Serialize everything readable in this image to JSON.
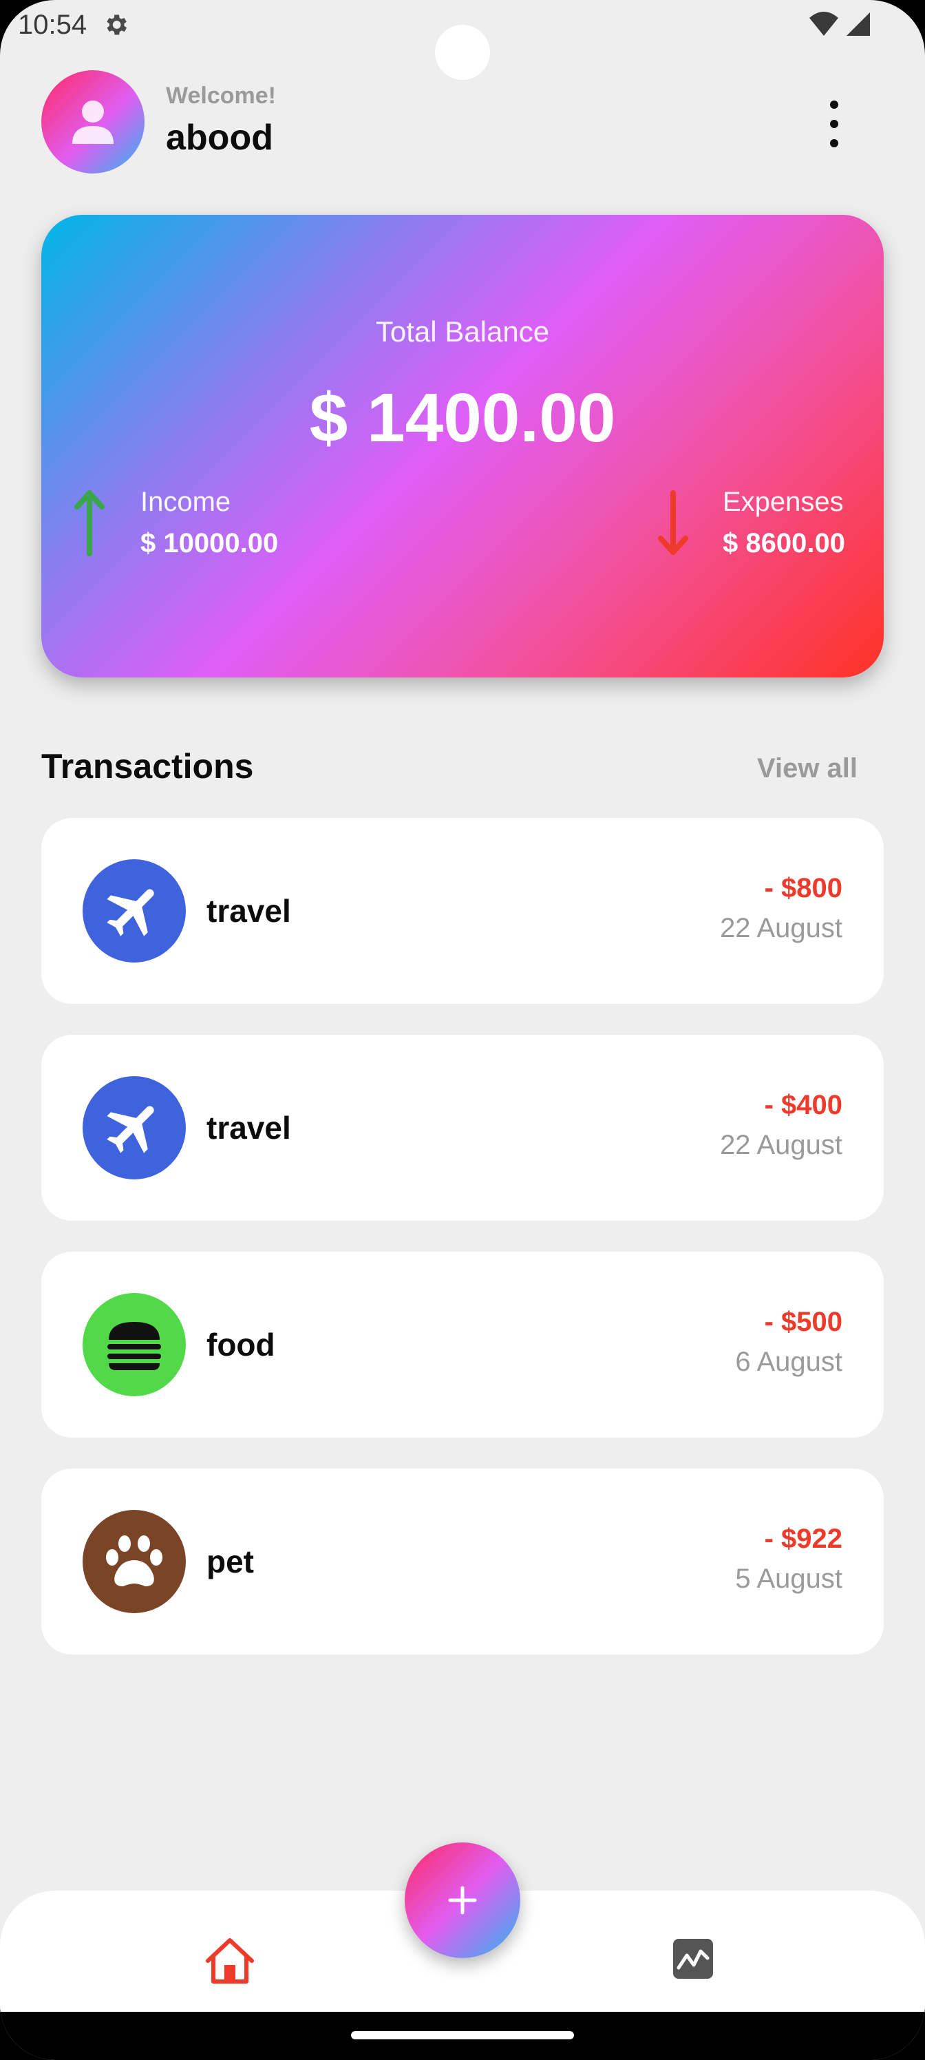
{
  "status_bar": {
    "time": "10:54"
  },
  "header": {
    "welcome": "Welcome!",
    "username": "abood"
  },
  "balance_card": {
    "label": "Total Balance",
    "amount": "$ 1400.00",
    "income_label": "Income",
    "income_value": "$ 10000.00",
    "expenses_label": "Expenses",
    "expenses_value": "$ 8600.00"
  },
  "transactions": {
    "title": "Transactions",
    "view_all": "View all",
    "items": [
      {
        "name": "travel",
        "amount": "- $800",
        "date": "22 August",
        "icon": "airplane-icon",
        "color": "#3f63dd"
      },
      {
        "name": "travel",
        "amount": "- $400",
        "date": "22 August",
        "icon": "airplane-icon",
        "color": "#3f63dd"
      },
      {
        "name": "food",
        "amount": "- $500",
        "date": "6 August",
        "icon": "burger-icon",
        "color": "#52d94a"
      },
      {
        "name": "pet",
        "amount": "- $922",
        "date": "5 August",
        "icon": "paw-icon",
        "color": "#7a4427"
      }
    ]
  },
  "colors": {
    "expense_red": "#ee3a2a",
    "income_green": "#3aa64a",
    "nav_active": "#ee3a2a"
  }
}
